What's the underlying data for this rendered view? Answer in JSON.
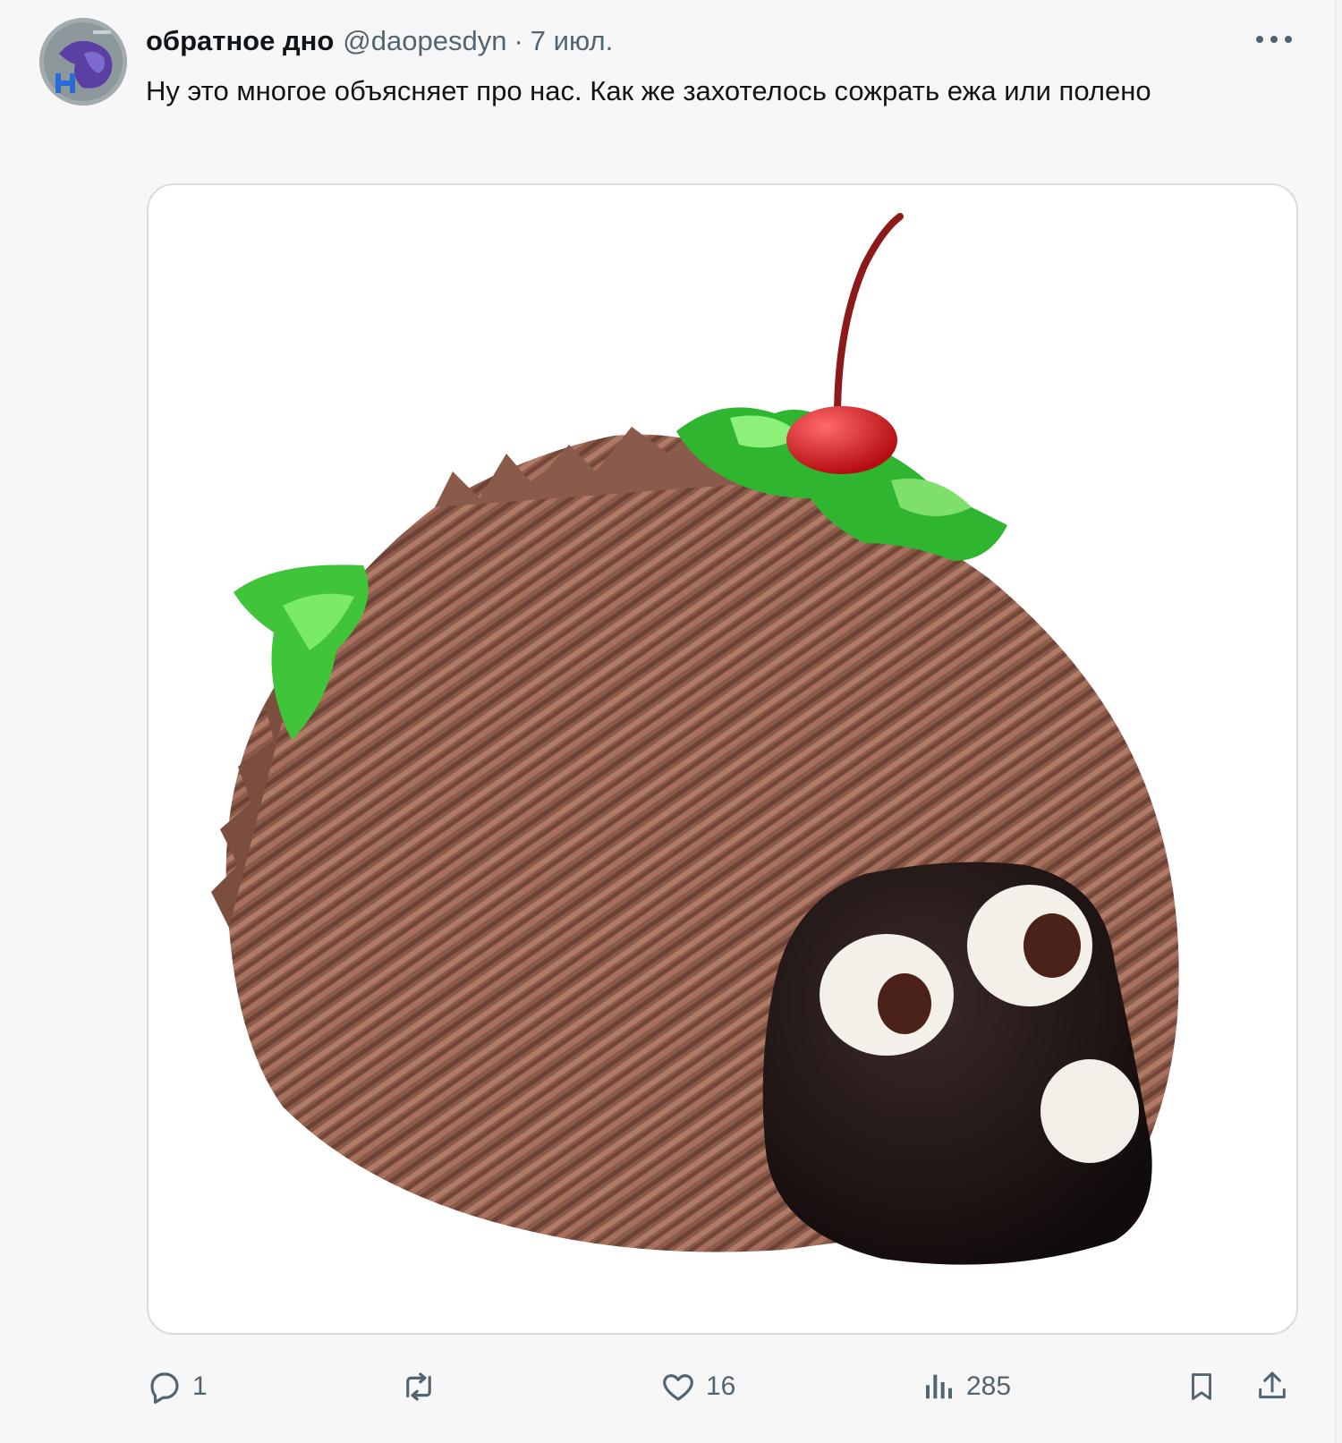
{
  "tweet": {
    "display_name": "обратное дно",
    "handle": "@daopesdyn",
    "separator": "·",
    "date": "7 июл.",
    "text": "Ну это многое объясняет про нас. Как же захотелось сожрать ежа или полено",
    "media_icon": "hedgehog-cake-image"
  },
  "actions": {
    "reply": {
      "icon": "reply-icon",
      "count": "1"
    },
    "retweet": {
      "icon": "retweet-icon",
      "count": ""
    },
    "like": {
      "icon": "heart-icon",
      "count": "16"
    },
    "views": {
      "icon": "views-chart-icon",
      "count": "285"
    },
    "bookmark": {
      "icon": "bookmark-icon"
    },
    "share": {
      "icon": "share-icon"
    }
  },
  "colors": {
    "secondary_text": "#536471",
    "primary_text": "#0f1419",
    "media_border": "#d5dde3"
  }
}
